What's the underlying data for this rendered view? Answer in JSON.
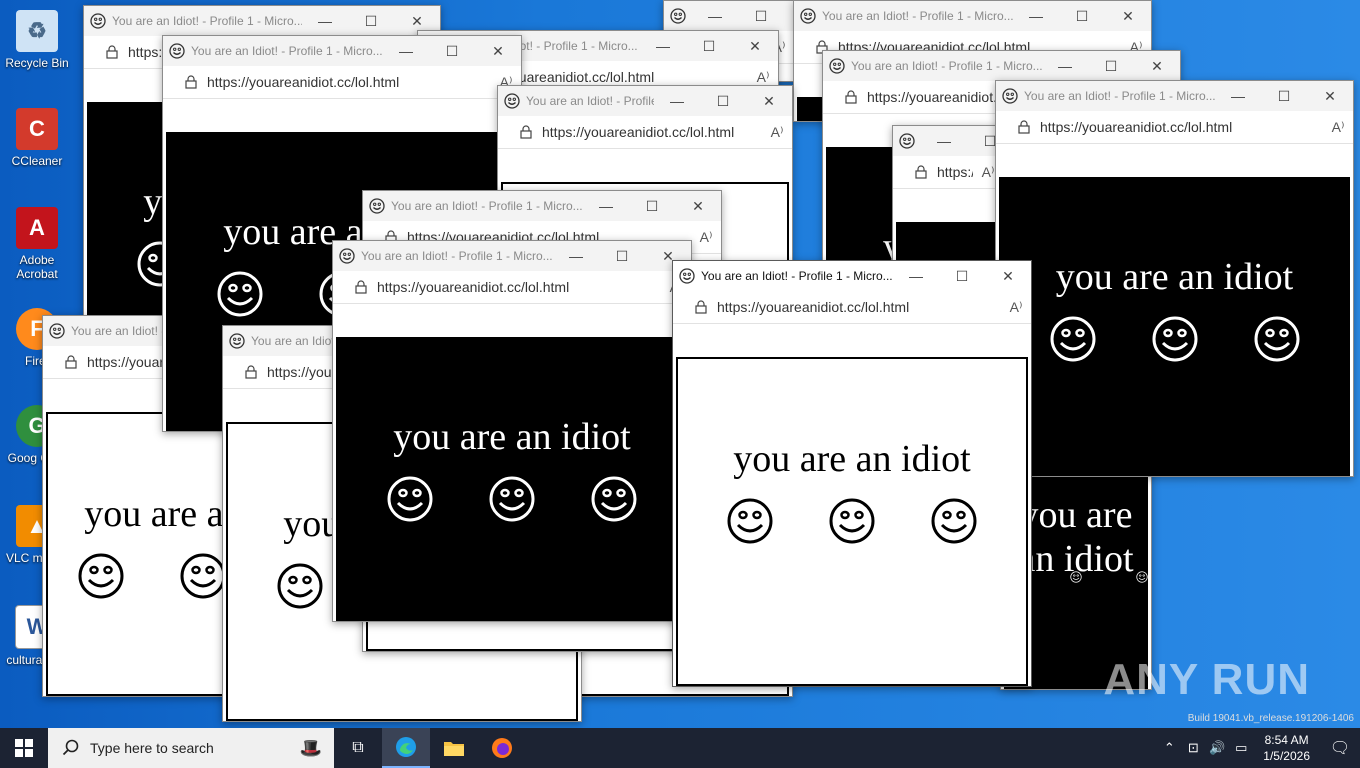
{
  "desktop": {
    "icons": [
      {
        "label": "Recycle Bin",
        "icon": "recycle-bin-icon",
        "color": "#cfe3f5"
      },
      {
        "label": "CCleaner",
        "icon": "ccleaner-icon",
        "color": "#d33a2c"
      },
      {
        "label": "Adobe Acrobat",
        "icon": "acrobat-icon",
        "color": "#c3141c"
      },
      {
        "label": "Firef",
        "icon": "firefox-icon",
        "color": "#ff8a1c"
      },
      {
        "label": "Goog Chro",
        "icon": "chrome-icon",
        "color": "#2f8f3e"
      },
      {
        "label": "VLC m play",
        "icon": "vlc-icon",
        "color": "#f28c00"
      },
      {
        "label": "culturalsu...",
        "icon": "word-doc-icon",
        "color": "#ffffff"
      }
    ]
  },
  "popup": {
    "title": "You are an Idiot! - Profile 1 - Micro...",
    "url": "https://youareanidiot.cc/lol.html",
    "message": "you are an idiot",
    "minimize": "—",
    "maximize": "☐",
    "close": "✕",
    "read_aloud": "A⁾"
  },
  "taskbar": {
    "search_placeholder": "Type here to search",
    "time": "8:54 AM",
    "date": "1/5/2026"
  },
  "watermark": "ANY RUN",
  "build_text": "Build 19041.vb_release.191206-1406"
}
